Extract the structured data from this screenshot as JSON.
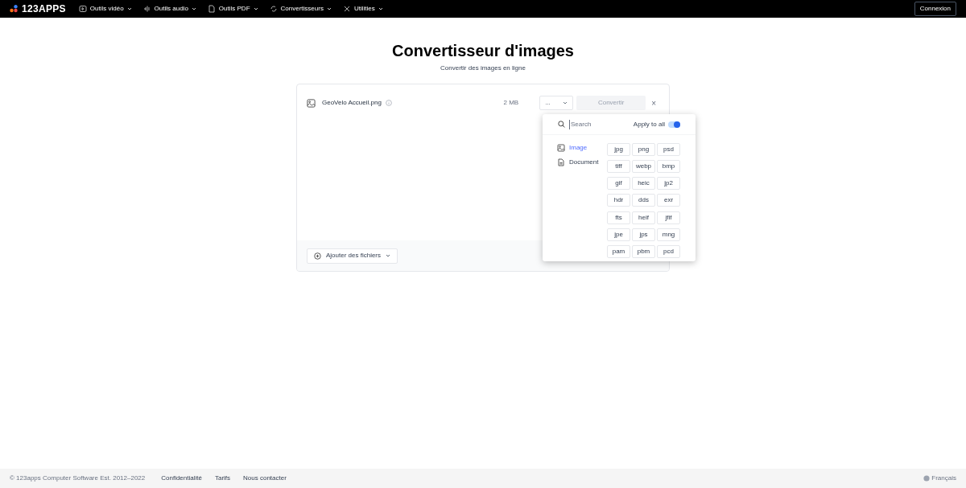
{
  "header": {
    "logo": "123APPS",
    "nav": [
      {
        "label": "Outils vidéo"
      },
      {
        "label": "Outils audio"
      },
      {
        "label": "Outils PDF"
      },
      {
        "label": "Convertisseurs"
      },
      {
        "label": "Utilities"
      }
    ],
    "login": "Connexion"
  },
  "title": "Convertisseur d'images",
  "subtitle": "Convertir des images en ligne",
  "file": {
    "name": "GeoVelo Accueil.png",
    "size": "2 MB",
    "format": "...",
    "convert": "Convertir",
    "remove": "×"
  },
  "add_files": "Ajouter des fichiers",
  "dropdown": {
    "search_placeholder": "Search",
    "apply_to_all_label": "Apply to all",
    "apply_to_all": true,
    "categories": [
      {
        "label": "Image",
        "kind": "image",
        "selected": true
      },
      {
        "label": "Document",
        "kind": "document",
        "selected": false
      }
    ],
    "formats": [
      "jpg",
      "png",
      "psd",
      "tiff",
      "webp",
      "bmp",
      "gif",
      "heic",
      "jp2",
      "hdr",
      "dds",
      "exr",
      "fts",
      "heif",
      "jfif",
      "jpe",
      "jps",
      "mng",
      "pam",
      "pbm",
      "pcd"
    ]
  },
  "footer": {
    "copyright": "© 123apps Computer Software Est. 2012–2022",
    "links": [
      "Confidentialité",
      "Tarifs",
      "Nous contacter"
    ],
    "language": "Français"
  }
}
